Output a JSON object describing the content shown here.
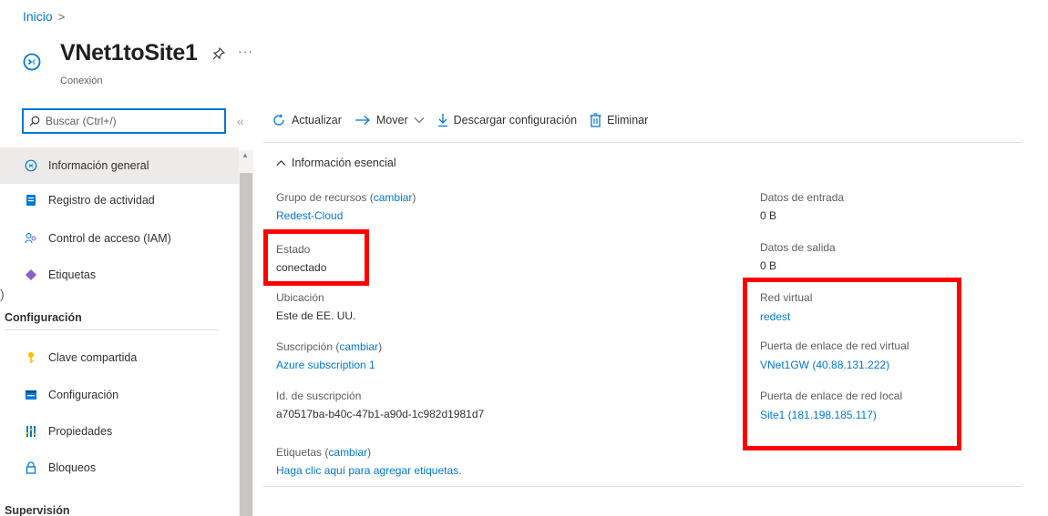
{
  "breadcrumb": {
    "home": "Inicio",
    "separator": ">"
  },
  "resource": {
    "title": "VNet1toSite1",
    "type": "Conexión",
    "more": "···"
  },
  "search": {
    "placeholder": "Buscar (Ctrl+/)",
    "collapse": "«"
  },
  "sidebar": {
    "items": [
      {
        "label": "Información general",
        "icon": "overview-icon",
        "active": true
      },
      {
        "label": "Registro de actividad",
        "icon": "activity-log-icon"
      },
      {
        "label": "Control de acceso (IAM)",
        "icon": "iam-icon"
      },
      {
        "label": "Etiquetas",
        "icon": "tag-icon"
      }
    ],
    "section_config": "Configuración",
    "config_items": [
      {
        "label": "Clave compartida",
        "icon": "key-icon"
      },
      {
        "label": "Configuración",
        "icon": "settings-icon"
      },
      {
        "label": "Propiedades",
        "icon": "properties-icon"
      },
      {
        "label": "Bloqueos",
        "icon": "lock-icon"
      }
    ],
    "section_monitor": "Supervisión"
  },
  "toolbar": {
    "refresh": "Actualizar",
    "move": "Mover",
    "download": "Descargar configuración",
    "delete": "Eliminar"
  },
  "essentials": {
    "header": "Información esencial",
    "change": "cambiar",
    "resource_group": {
      "label": "Grupo de recursos",
      "value": "Redest-Cloud"
    },
    "status": {
      "label": "Estado",
      "value": "conectado"
    },
    "location": {
      "label": "Ubicación",
      "value": "Este de EE. UU."
    },
    "subscription": {
      "label": "Suscripción",
      "value": "Azure subscription 1"
    },
    "subscription_id": {
      "label": "Id. de suscripción",
      "value": "a70517ba-b40c-47b1-a90d-1c982d1981d7"
    },
    "tags": {
      "label": "Etiquetas",
      "value": "Haga clic aquí para agregar etiquetas."
    },
    "data_in": {
      "label": "Datos de entrada",
      "value": "0 B"
    },
    "data_out": {
      "label": "Datos de salida",
      "value": "0 B"
    },
    "vnet": {
      "label": "Red virtual",
      "value": "redest"
    },
    "vnet_gateway": {
      "label": "Puerta de enlace de red virtual",
      "value": "VNet1GW (40.88.131.222)"
    },
    "local_gateway": {
      "label": "Puerta de enlace de red local",
      "value": "Site1 (181.198.185.117)"
    }
  },
  "colors": {
    "accent": "#0078d4",
    "highlight": "#ff0000"
  }
}
